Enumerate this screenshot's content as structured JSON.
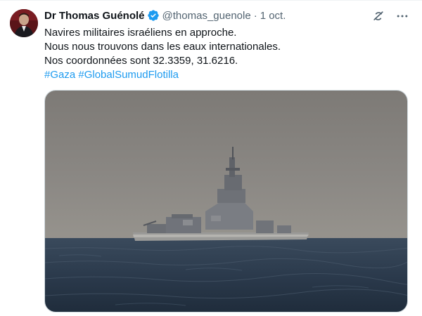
{
  "tweet": {
    "author_name": "Dr Thomas Guénolé",
    "handle": "@thomas_guenole",
    "separator": "·",
    "date": "1 oct.",
    "text_lines": [
      "Navires militaires israéliens en approche.",
      "Nous nous trouvons dans les eaux internationales.",
      "Nos coordonnées sont 32.3359, 31.6216."
    ],
    "hashtags": [
      "#Gaza",
      "#GlobalSumudFlotilla"
    ],
    "verified_icon": "verified-badge-icon",
    "colors": {
      "link": "#1d9bf0",
      "secondary_text": "#536471",
      "primary_text": "#0f1419"
    }
  },
  "actions": {
    "grok_icon": "grok-icon",
    "more_icon": "more-options-icon"
  },
  "media": {
    "icon": "photo-warship-at-sea"
  }
}
